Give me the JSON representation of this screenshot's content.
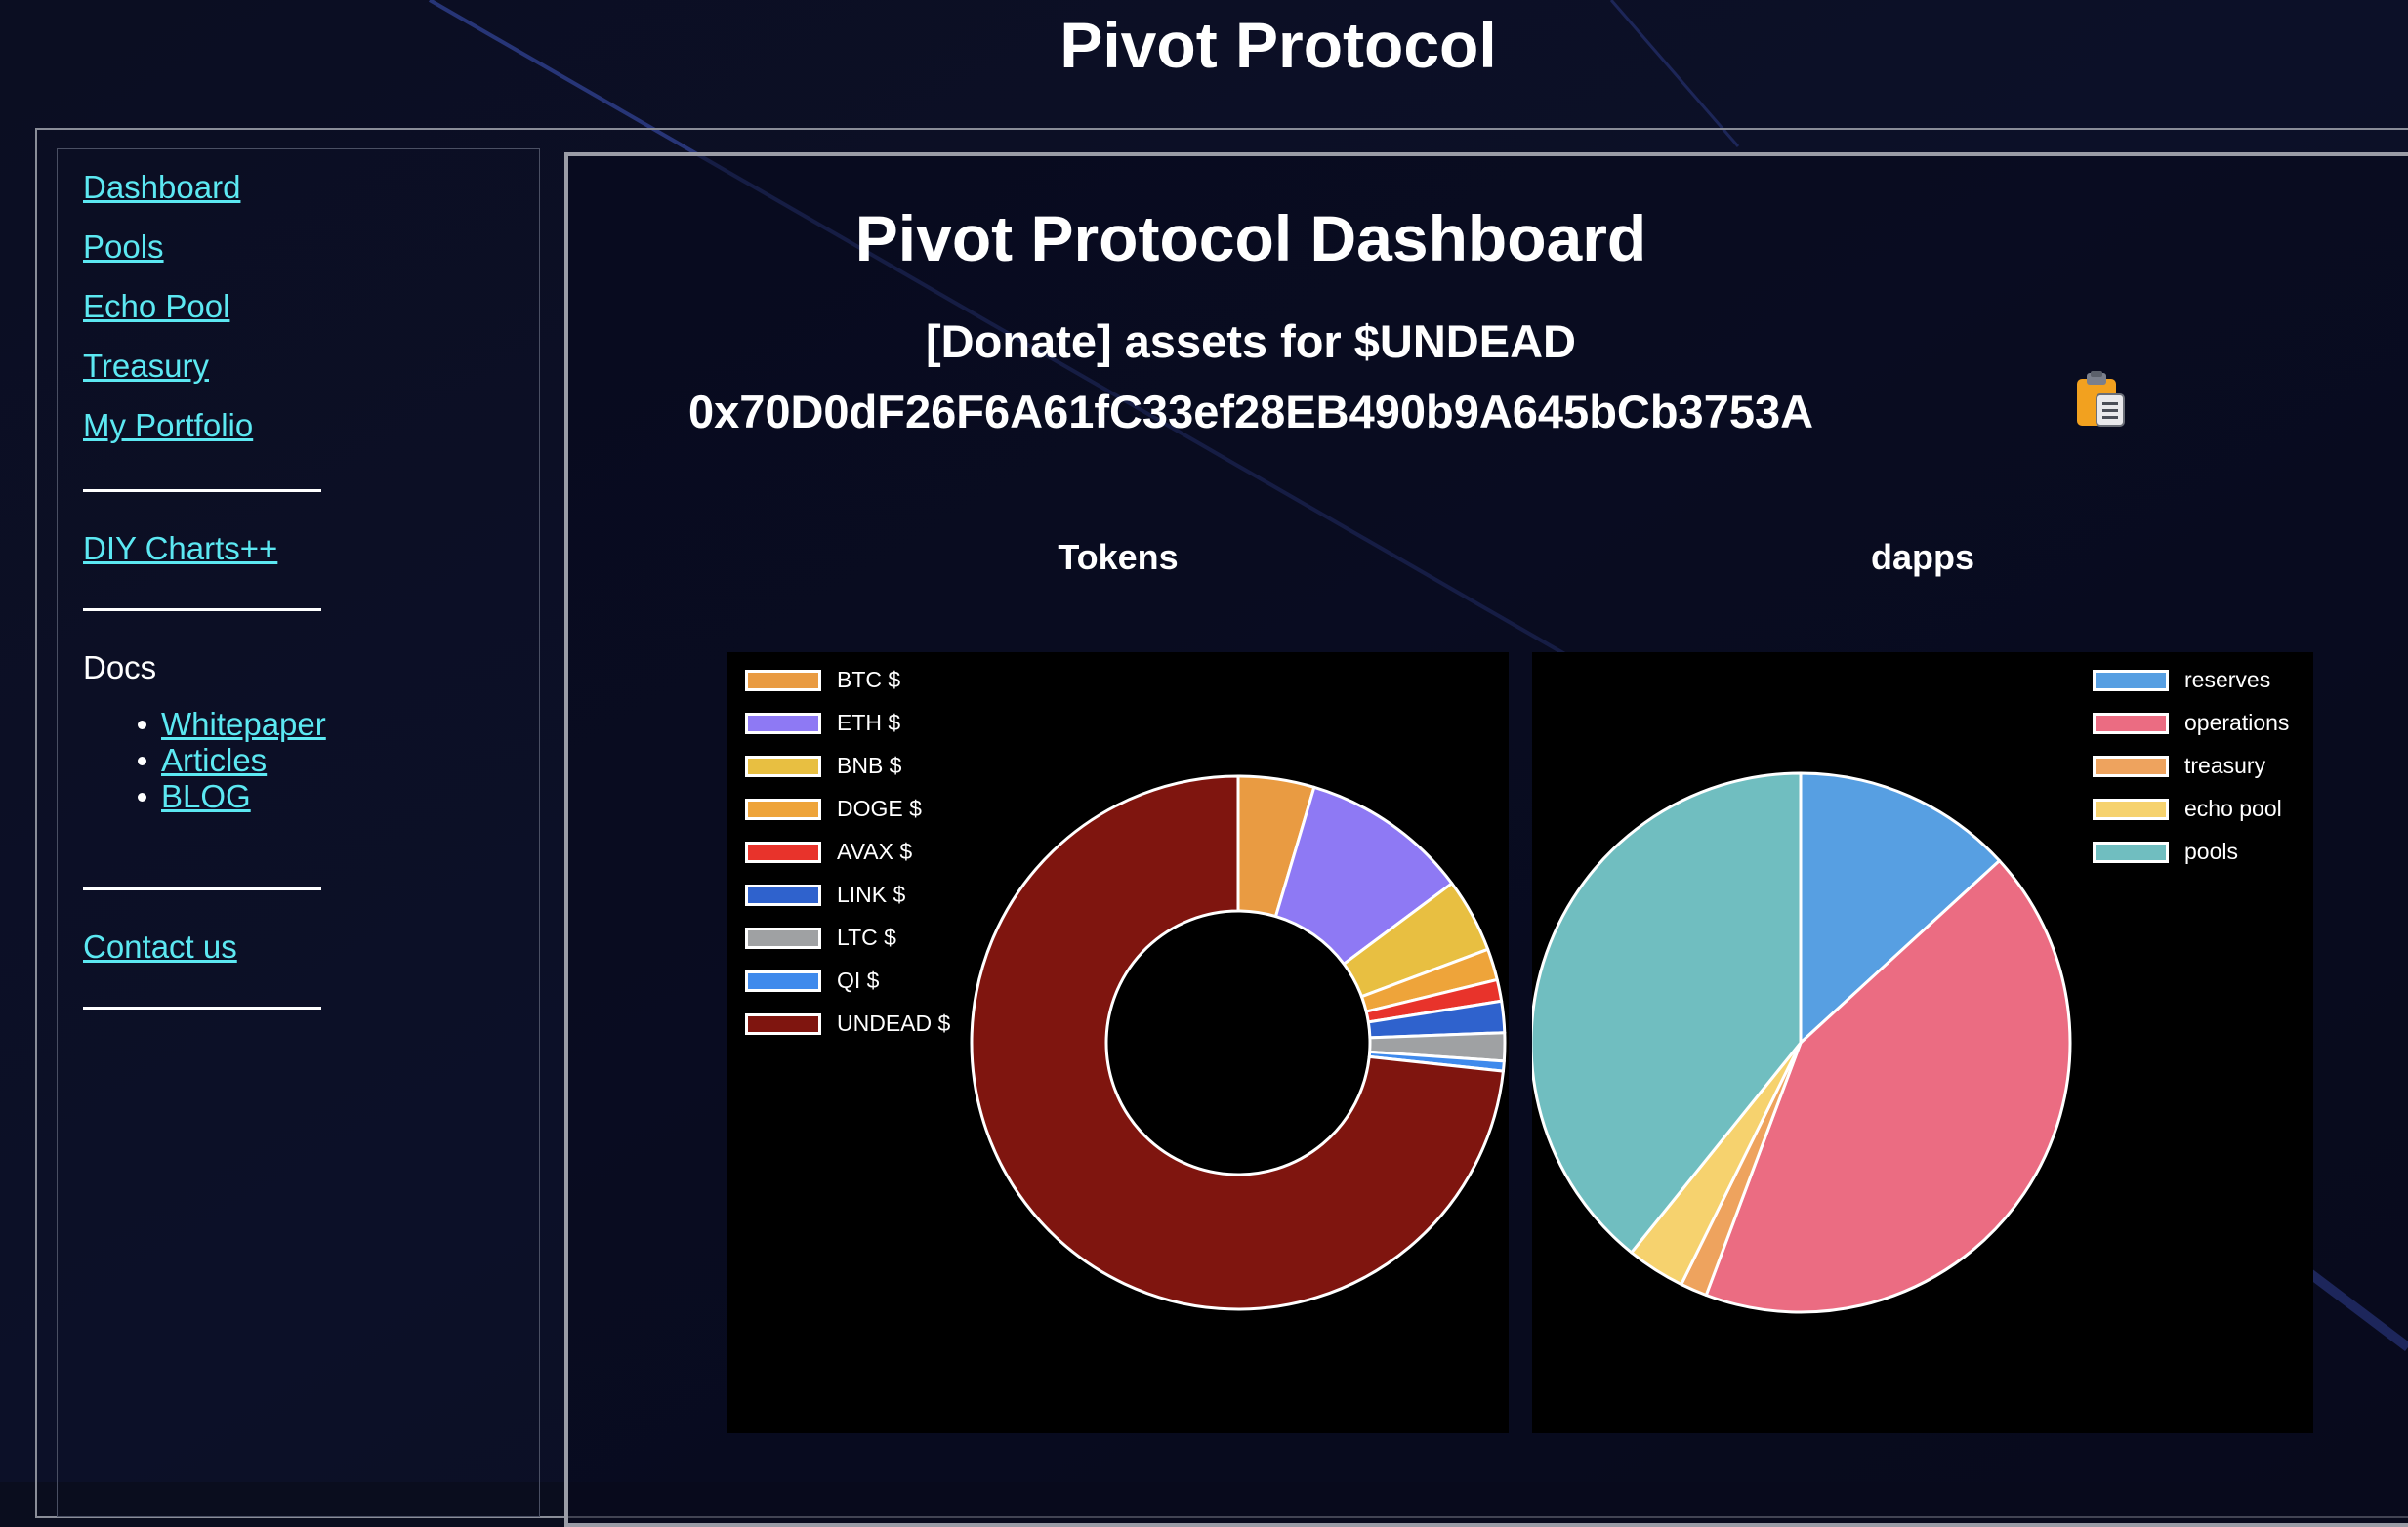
{
  "site_title": "Pivot Protocol",
  "sidebar": {
    "links": [
      {
        "label": "Dashboard"
      },
      {
        "label": "Pools"
      },
      {
        "label": "Echo Pool"
      },
      {
        "label": "Treasury"
      },
      {
        "label": "My Portfolio"
      }
    ],
    "diy_charts": "DIY Charts++",
    "docs_heading": "Docs",
    "docs_links": [
      {
        "label": "Whitepaper"
      },
      {
        "label": "Articles"
      },
      {
        "label": "BLOG"
      }
    ],
    "contact": "Contact us"
  },
  "main": {
    "title": "Pivot Protocol Dashboard",
    "donate_text": "[Donate] assets for $UNDEAD",
    "address": "0x70D0dF26F6A61fC33ef28EB490b9A645bCb3753A",
    "copy_icon": "clipboard-icon"
  },
  "colors": {
    "background": "#0a0d1e",
    "link": "#5ce8f2",
    "chart_background": "#000000",
    "slice_border": "#ffffff"
  },
  "chart_data": [
    {
      "type": "pie",
      "variant": "doughnut",
      "title": "Tokens",
      "categories": [
        "BTC $",
        "ETH $",
        "BNB $",
        "DOGE $",
        "AVAX $",
        "LINK $",
        "LTC $",
        "QI $",
        "UNDEAD $"
      ],
      "values": [
        4.6,
        10.2,
        4.5,
        1.9,
        1.3,
        1.9,
        1.7,
        0.6,
        73.3
      ],
      "colors": [
        "#e99b42",
        "#8e79f4",
        "#e8bf41",
        "#eea43a",
        "#e8332b",
        "#2f62cd",
        "#9fa1a3",
        "#3f8aec",
        "#7f150f"
      ],
      "legend": "top-left"
    },
    {
      "type": "pie",
      "title": "dapps",
      "categories": [
        "reserves",
        "operations",
        "treasury",
        "echo pool",
        "pools"
      ],
      "values": [
        13.2,
        42.5,
        1.6,
        3.5,
        39.2
      ],
      "colors": [
        "#579fe2",
        "#eb6c82",
        "#eea35e",
        "#f6d26e",
        "#70bec0"
      ],
      "legend": "top-right"
    }
  ]
}
